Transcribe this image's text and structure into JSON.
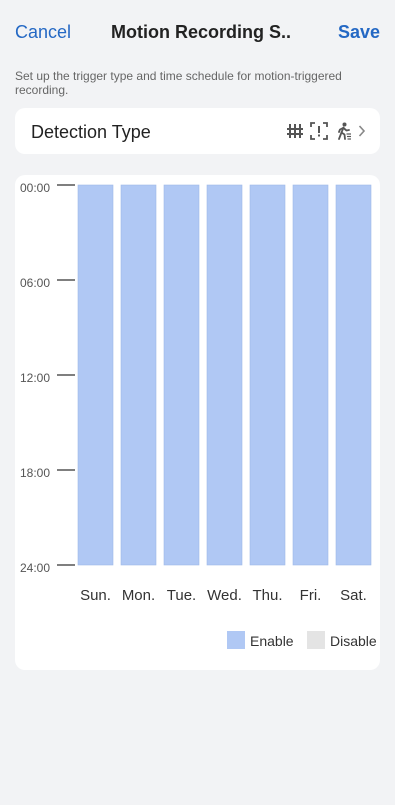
{
  "header": {
    "cancel_label": "Cancel",
    "title": "Motion Recording S...",
    "save_label": "Save"
  },
  "description": "Set up the trigger type and time schedule for motion-triggered recording.",
  "detection": {
    "label": "Detection Type",
    "icons": [
      "line-crossing-icon",
      "intrusion-icon",
      "human-motion-icon",
      "chevron-right-icon"
    ]
  },
  "schedule": {
    "time_labels": [
      "00:00",
      "06:00",
      "12:00",
      "18:00",
      "24:00"
    ],
    "days": [
      "Sun.",
      "Mon.",
      "Tue.",
      "Wed.",
      "Thu.",
      "Fri.",
      "Sat."
    ],
    "enabled_ranges": [
      {
        "day": "Sun.",
        "start": "00:00",
        "end": "24:00"
      },
      {
        "day": "Mon.",
        "start": "00:00",
        "end": "24:00"
      },
      {
        "day": "Tue.",
        "start": "00:00",
        "end": "24:00"
      },
      {
        "day": "Wed.",
        "start": "00:00",
        "end": "24:00"
      },
      {
        "day": "Thu.",
        "start": "00:00",
        "end": "24:00"
      },
      {
        "day": "Fri.",
        "start": "00:00",
        "end": "24:00"
      },
      {
        "day": "Sat.",
        "start": "00:00",
        "end": "24:00"
      }
    ]
  },
  "legend": {
    "enable_label": "Enable",
    "disable_label": "Disable",
    "enable_color": "#b0c8f4",
    "disable_color": "#e4e4e4"
  },
  "colors": {
    "accent": "#2468c4",
    "background": "#f2f3f5"
  }
}
